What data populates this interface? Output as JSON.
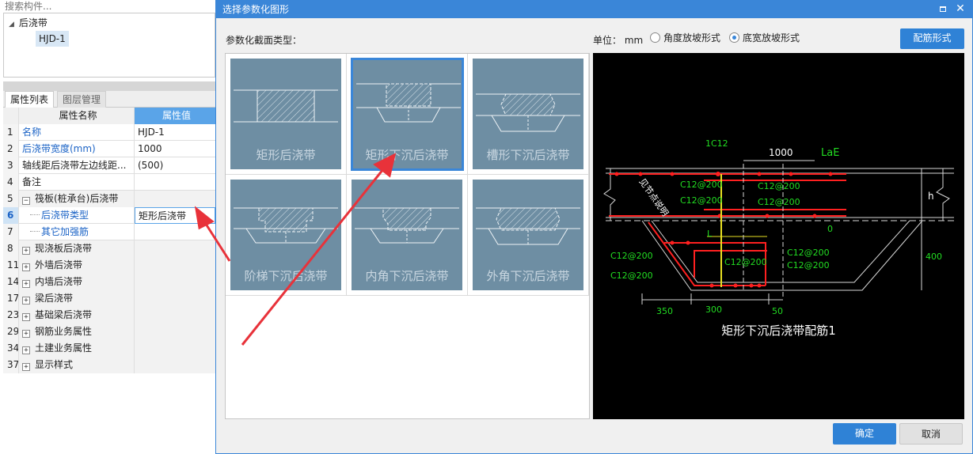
{
  "left_panel": {
    "search_placeholder": "搜索构件...",
    "tree": {
      "root": "后浇带",
      "child": "HJD-1"
    },
    "tabs": [
      "属性列表",
      "图层管理"
    ],
    "grid_header": {
      "name": "属性名称",
      "value": "属性值"
    },
    "rows": [
      {
        "num": "1",
        "name": "名称",
        "value": "HJD-1"
      },
      {
        "num": "2",
        "name": "后浇带宽度(mm)",
        "value": "1000"
      },
      {
        "num": "3",
        "name": "轴线距后浇带左边线距...",
        "value": "(500)"
      },
      {
        "num": "4",
        "name": "备注",
        "value": ""
      },
      {
        "num": "5",
        "name": "筏板(桩承台)后浇带",
        "value": ""
      },
      {
        "num": "6",
        "name": "后浇带类型",
        "value": "矩形后浇带"
      },
      {
        "num": "7",
        "name": "其它加强筋",
        "value": ""
      },
      {
        "num": "8",
        "name": "现浇板后浇带",
        "value": ""
      },
      {
        "num": "11",
        "name": "外墙后浇带",
        "value": ""
      },
      {
        "num": "14",
        "name": "内墙后浇带",
        "value": ""
      },
      {
        "num": "17",
        "name": "梁后浇带",
        "value": ""
      },
      {
        "num": "23",
        "name": "基础梁后浇带",
        "value": ""
      },
      {
        "num": "29",
        "name": "钢筋业务属性",
        "value": ""
      },
      {
        "num": "34",
        "name": "土建业务属性",
        "value": ""
      },
      {
        "num": "37",
        "name": "显示样式",
        "value": ""
      }
    ],
    "expand_minus": "−",
    "expand_plus": "+"
  },
  "dialog": {
    "title": "选择参数化图形",
    "close_glyph": "✕",
    "section_label": "参数化截面类型：",
    "unit_label": "单位：  mm",
    "radio_angle": "角度放坡形式",
    "radio_width": "底宽放坡形式",
    "radio_selected": "底宽放坡形式",
    "rebar_button": "配筋形式",
    "shapes": [
      "矩形后浇带",
      "矩形下沉后浇带",
      "槽形下沉后浇带",
      "阶梯下沉后浇带",
      "内角下沉后浇带",
      "外角下沉后浇带"
    ],
    "selected_shape": "矩形下沉后浇带",
    "preview": {
      "caption": "矩形下沉后浇带配筋1",
      "labels": {
        "top_bar": "1C12",
        "width": "1000",
        "lae": "LaE",
        "h": "h",
        "zero": "0",
        "l": "L",
        "depth": "400",
        "dim_350": "350",
        "dim_300": "300",
        "dim_50": "50",
        "rebar": "C12@200",
        "slope_text": "见节点说明"
      }
    },
    "ok": "确定",
    "cancel": "取消"
  },
  "colors": {
    "accent": "#3a86d8",
    "thumb_bg": "#6e8ea3",
    "rebar_red": "#ff2020",
    "cad_green": "#22dd22",
    "arrow_red": "#e8323a"
  }
}
